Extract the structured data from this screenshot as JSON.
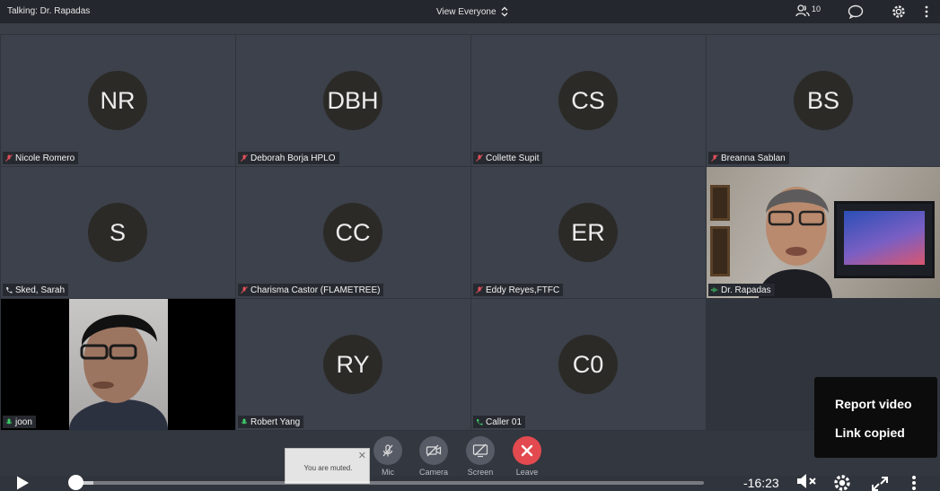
{
  "topbar": {
    "talking": "Talking: Dr. Rapadas",
    "view": "View Everyone",
    "participants": "10"
  },
  "tiles": [
    {
      "initials": "NR",
      "name": "Nicole Romero",
      "mic": "muted"
    },
    {
      "initials": "DBH",
      "name": "Deborah Borja HPLO",
      "mic": "muted"
    },
    {
      "initials": "CS",
      "name": "Collette Supit",
      "mic": "muted"
    },
    {
      "initials": "BS",
      "name": "Breanna Sablan",
      "mic": "muted"
    },
    {
      "initials": "S",
      "name": "Sked, Sarah",
      "mic": "phone"
    },
    {
      "initials": "CC",
      "name": "Charisma Castor (FLAMETREE)",
      "mic": "muted"
    },
    {
      "initials": "ER",
      "name": "Eddy Reyes,FTFC",
      "mic": "muted"
    },
    {
      "initials": "",
      "name": "Dr. Rapadas",
      "mic": "speaking"
    },
    {
      "initials": "",
      "name": "joon",
      "mic": "on"
    },
    {
      "initials": "RY",
      "name": "Robert Yang",
      "mic": "on"
    },
    {
      "initials": "C0",
      "name": "Caller 01",
      "mic": "phone"
    }
  ],
  "controls": {
    "mic": "Mic",
    "camera": "Camera",
    "screen": "Screen",
    "leave": "Leave"
  },
  "toast": {
    "text": "You are muted."
  },
  "context_menu": {
    "item1": "Report video",
    "item2": "Link copied"
  },
  "player": {
    "time": "-16:23",
    "progress": 0.0
  },
  "colors": {
    "muted": "#e0505a",
    "on": "#3ecf6a",
    "leave": "#e24a4f"
  }
}
